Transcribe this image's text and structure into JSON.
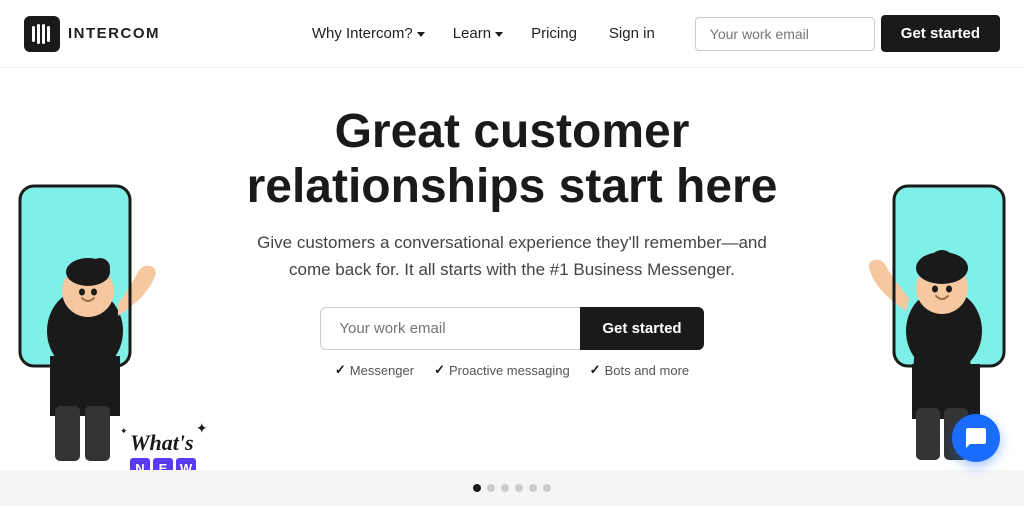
{
  "nav": {
    "logo_text": "INTERCOM",
    "links": [
      {
        "label": "Why Intercom?",
        "has_dropdown": true
      },
      {
        "label": "Learn",
        "has_dropdown": true
      },
      {
        "label": "Pricing",
        "has_dropdown": false
      },
      {
        "label": "Sign in",
        "has_dropdown": false
      }
    ],
    "email_placeholder": "Your work email",
    "cta_label": "Get started"
  },
  "hero": {
    "title_line1": "Great customer",
    "title_line2": "relationships start here",
    "subtitle": "Give customers a conversational experience they'll remember—and come back for. It all starts with the #1 Business Messenger.",
    "email_placeholder": "Your work email",
    "cta_label": "Get started",
    "checks": [
      {
        "label": "Messenger"
      },
      {
        "label": "Proactive messaging"
      },
      {
        "label": "Bots and more"
      }
    ]
  },
  "whats_new": {
    "text": "What's",
    "badge_letters": [
      "N",
      "E",
      "W"
    ]
  },
  "dots": [
    {
      "active": true
    },
    {
      "active": false
    },
    {
      "active": false
    },
    {
      "active": false
    },
    {
      "active": false
    },
    {
      "active": false
    }
  ],
  "colors": {
    "brand_dark": "#1a1a1a",
    "accent_purple": "#5b3af5",
    "accent_blue": "#1a6cff",
    "teal_bg": "#7ef0e8"
  }
}
